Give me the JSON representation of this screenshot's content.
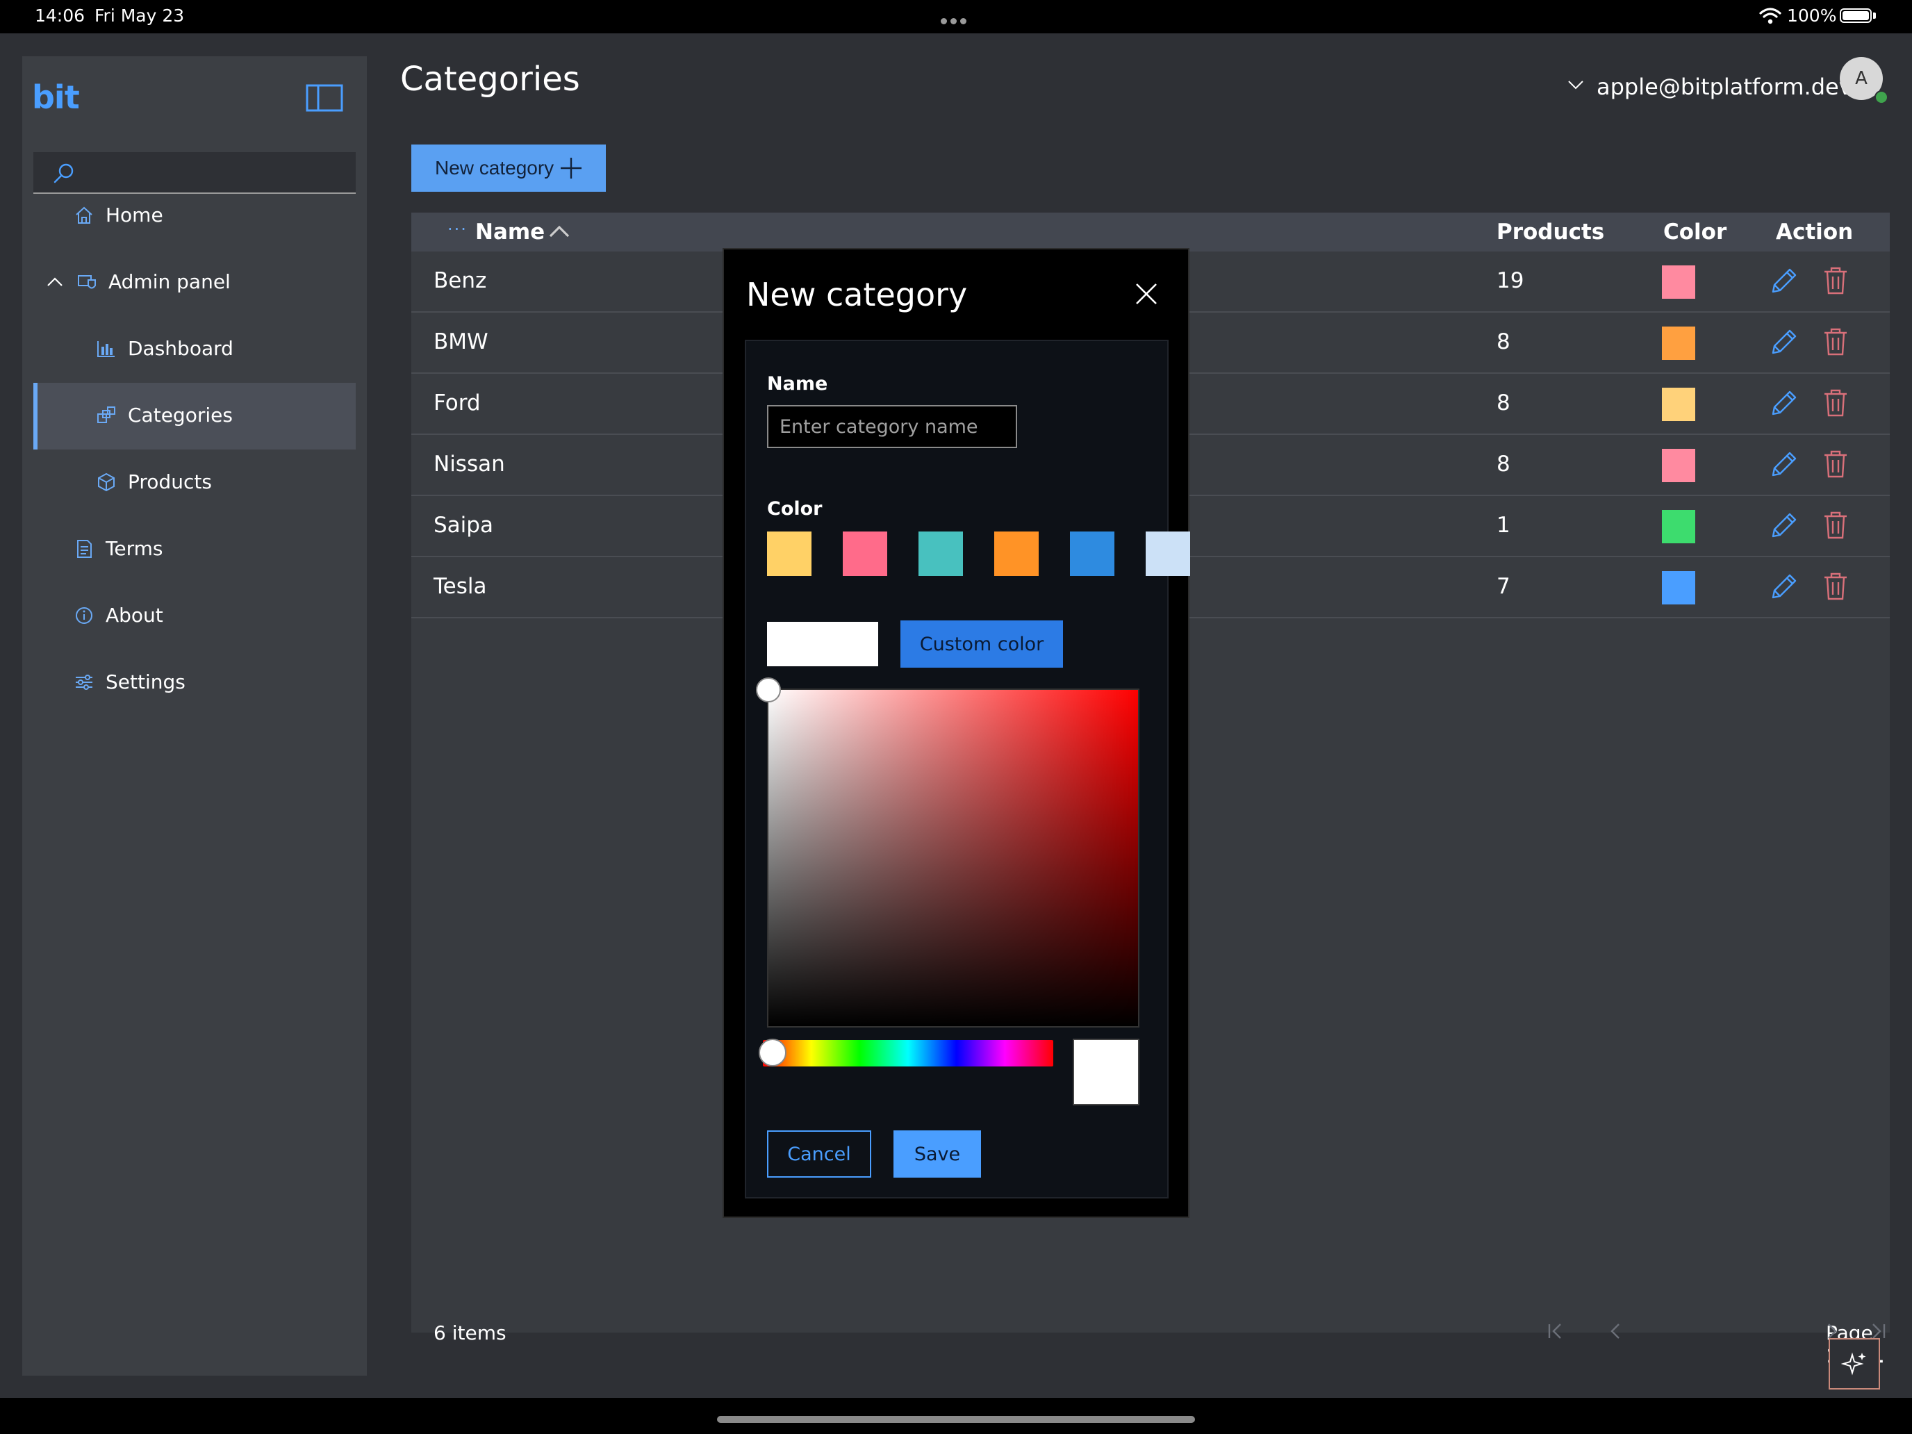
{
  "status_bar": {
    "time": "14:06",
    "date": "Fri May 23",
    "battery": "100%"
  },
  "sidebar": {
    "logo": "bit",
    "search_placeholder": "",
    "items": [
      {
        "label": "Home",
        "icon": "home-icon"
      },
      {
        "label": "Admin panel",
        "icon": "admin-icon"
      },
      {
        "label": "Dashboard",
        "icon": "chart-icon"
      },
      {
        "label": "Categories",
        "icon": "categories-icon"
      },
      {
        "label": "Products",
        "icon": "box-icon"
      },
      {
        "label": "Terms",
        "icon": "document-icon"
      },
      {
        "label": "About",
        "icon": "info-icon"
      },
      {
        "label": "Settings",
        "icon": "sliders-icon"
      }
    ]
  },
  "header": {
    "title": "Categories",
    "user_email": "apple@bitplatform.dev",
    "avatar_initial": "A"
  },
  "toolbar": {
    "new_category_label": "New category"
  },
  "table": {
    "columns": {
      "name": "Name",
      "products": "Products",
      "color": "Color",
      "action": "Action"
    },
    "rows": [
      {
        "name": "Benz",
        "products": "19",
        "color": "#ff8aa0"
      },
      {
        "name": "BMW",
        "products": "8",
        "color": "#ffa040"
      },
      {
        "name": "Ford",
        "products": "8",
        "color": "#ffd27a"
      },
      {
        "name": "Nissan",
        "products": "8",
        "color": "#ff8aa0"
      },
      {
        "name": "Saipa",
        "products": "1",
        "color": "#3ddc6e"
      },
      {
        "name": "Tesla",
        "products": "7",
        "color": "#4a9eff"
      }
    ],
    "footer": {
      "items_count": "6 items",
      "page_prefix": "Page",
      "page_current": "1",
      "page_of": "of",
      "page_total": "1"
    }
  },
  "modal": {
    "title": "New category",
    "name_label": "Name",
    "name_placeholder": "Enter category name",
    "color_label": "Color",
    "preset_colors": [
      "#ffd166",
      "#ff6b8a",
      "#48c1bf",
      "#ff9326",
      "#2e8be0",
      "#cce1f7"
    ],
    "current_color": "#ffffff",
    "custom_color_label": "Custom color",
    "cancel_label": "Cancel",
    "save_label": "Save"
  },
  "colors": {
    "accent": "#4a9eff",
    "danger": "#d9707a"
  }
}
